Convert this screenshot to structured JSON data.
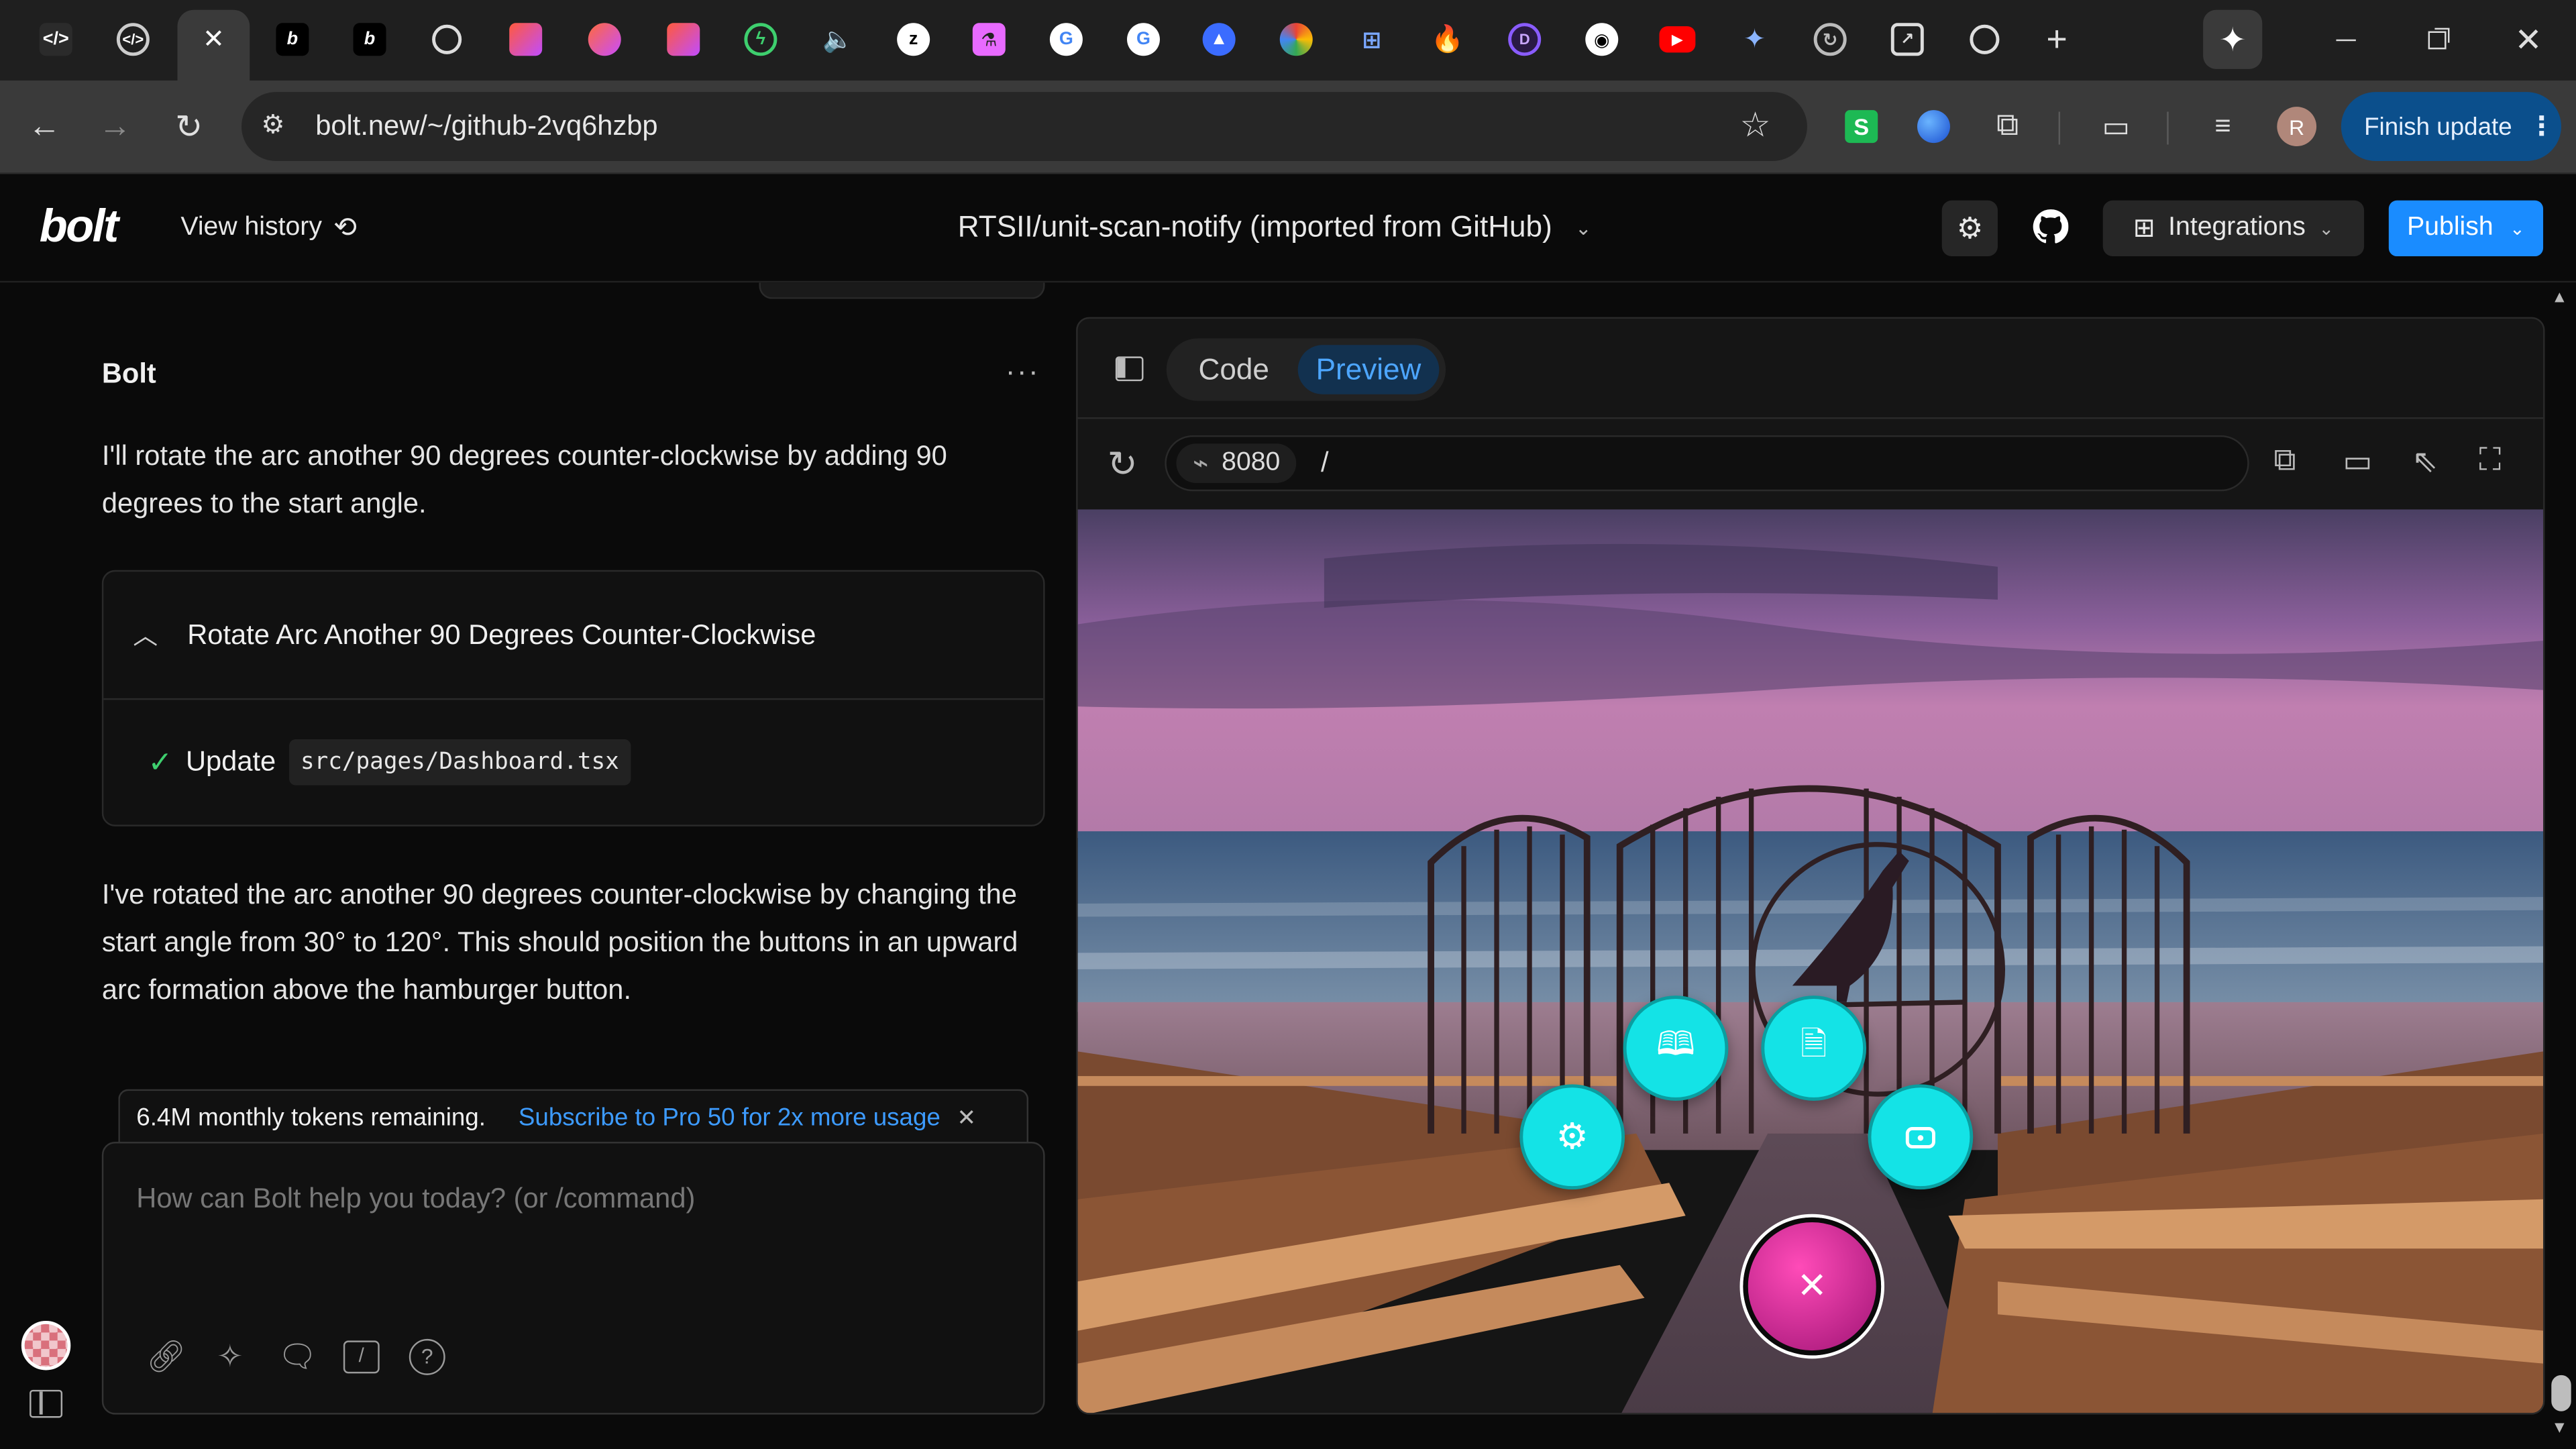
{
  "browser": {
    "url": "bolt.new/~/github-2vq6hzbp",
    "profile_initial": "R",
    "finish_update_label": "Finish update",
    "active_tab_close": "✕",
    "new_tab": "+"
  },
  "header": {
    "logo": "bolt",
    "view_history": "View history",
    "project_title": "RTSII/unit-scan-notify (imported from GitHub)",
    "integrations": "Integrations",
    "publish": "Publish"
  },
  "chat": {
    "author": "Bolt",
    "message1": "I'll rotate the arc another 90 degrees counter-clockwise by adding 90 degrees to the start angle.",
    "action_title": "Rotate Arc Another 90 Degrees Counter-Clockwise",
    "action_verb": "Update",
    "action_file": "src/pages/Dashboard.tsx",
    "message2": "I've rotated the arc another 90 degrees counter-clockwise by changing the start angle from 30° to 120°. This should position the buttons in an upward arc formation above the hamburger button.",
    "tokens_text": "6.4M monthly tokens remaining.",
    "subscribe_link": "Subscribe to Pro 50 for 2x more usage",
    "input_placeholder": "How can Bolt help you today? (or /command)"
  },
  "preview": {
    "tab_code": "Code",
    "tab_preview": "Preview",
    "port": "8080",
    "path": "/"
  },
  "colors": {
    "accent": "#1a8cff",
    "fab": "#14e3e6",
    "hamburger": "#d61c9a",
    "link": "#3d9bff"
  }
}
